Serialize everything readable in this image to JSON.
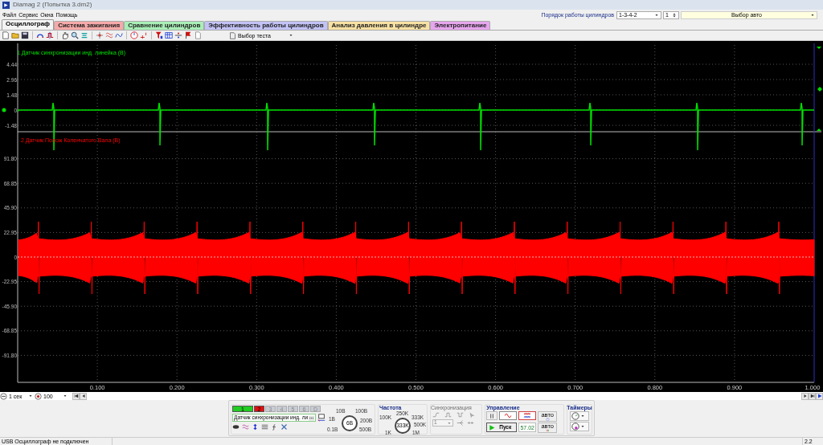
{
  "window": {
    "title": "Diamag 2 (Попытка 3.dm2)"
  },
  "menu": [
    "Файл",
    "Сервис",
    "Окна",
    "Помощь"
  ],
  "cylinder_order": {
    "label": "Порядок работы цилиндров",
    "value": "1-3-4-2",
    "spin_value": "1",
    "car_select": "Выбор авто"
  },
  "tabs": [
    {
      "label": "Осциллограф",
      "selected": true,
      "color": "#f4f4f4"
    },
    {
      "label": "Система зажигания",
      "selected": false,
      "color": "#f7a9a9"
    },
    {
      "label": "Сравнение цилиндров",
      "selected": false,
      "color": "#a9efb7"
    },
    {
      "label": "Эффективность работы цилиндров",
      "selected": false,
      "color": "#c3c3f7"
    },
    {
      "label": "Анализ давления в цилиндре",
      "selected": false,
      "color": "#f8e1a3"
    },
    {
      "label": "Электропитание",
      "selected": false,
      "color": "#e8a6ef"
    }
  ],
  "toolbar": {
    "test_select": "Выбор теста"
  },
  "plot": {
    "channels": [
      {
        "label": "1 Датчик синхронизации инд. линейка (В)",
        "color": "#00e000",
        "yticks": [
          "4.44",
          "2.96",
          "1.48",
          "0",
          "-1.48"
        ]
      },
      {
        "label": "2 Датчик Полож Коленчатого Вала (В)",
        "color": "#ff0000",
        "yticks": [
          "91.80",
          "68.85",
          "45.90",
          "22.95",
          "0",
          "-22.95",
          "-45.90",
          "-68.85",
          "-91.80"
        ]
      }
    ],
    "xticks": [
      "0.100",
      "0.200",
      "0.300",
      "0.400",
      "0.500",
      "0.600",
      "0.700",
      "0.800",
      "0.900",
      "1.000"
    ]
  },
  "timebase": {
    "time": "1 сек",
    "zoom": "100"
  },
  "panel": {
    "channel_buttons": [
      {
        "label": "1",
        "on": true,
        "color": "#22cc22"
      },
      {
        "label": "2",
        "on": true,
        "color": "#e01010"
      },
      {
        "label": "3",
        "on": false
      },
      {
        "label": "4",
        "on": false
      },
      {
        "label": "5",
        "on": false
      },
      {
        "label": "6",
        "on": false
      },
      {
        "label": "D",
        "on": false
      }
    ],
    "channel_select": "Датчик синхронизации инд. ли",
    "voltage_knob": {
      "labels": [
        "10В",
        "100В",
        "1В",
        "200В",
        "0.1В",
        "500В"
      ],
      "value": "6В"
    },
    "frequency": {
      "title": "Частота",
      "labels": [
        "250K",
        "100K",
        "333K",
        "500K",
        "1K",
        "1M"
      ],
      "value": "333K"
    },
    "sync": {
      "title": "Синхронизация",
      "disabled": true,
      "channel": "1"
    },
    "control": {
      "title": "Управление",
      "start": "Пуск",
      "rpm": "57.02",
      "auto_labels": [
        "авто",
        "авто"
      ]
    },
    "timers": {
      "title": "Таймеры"
    }
  },
  "status_bar": {
    "message": "USB Осциллограф не подключен",
    "version": "2.2"
  }
}
